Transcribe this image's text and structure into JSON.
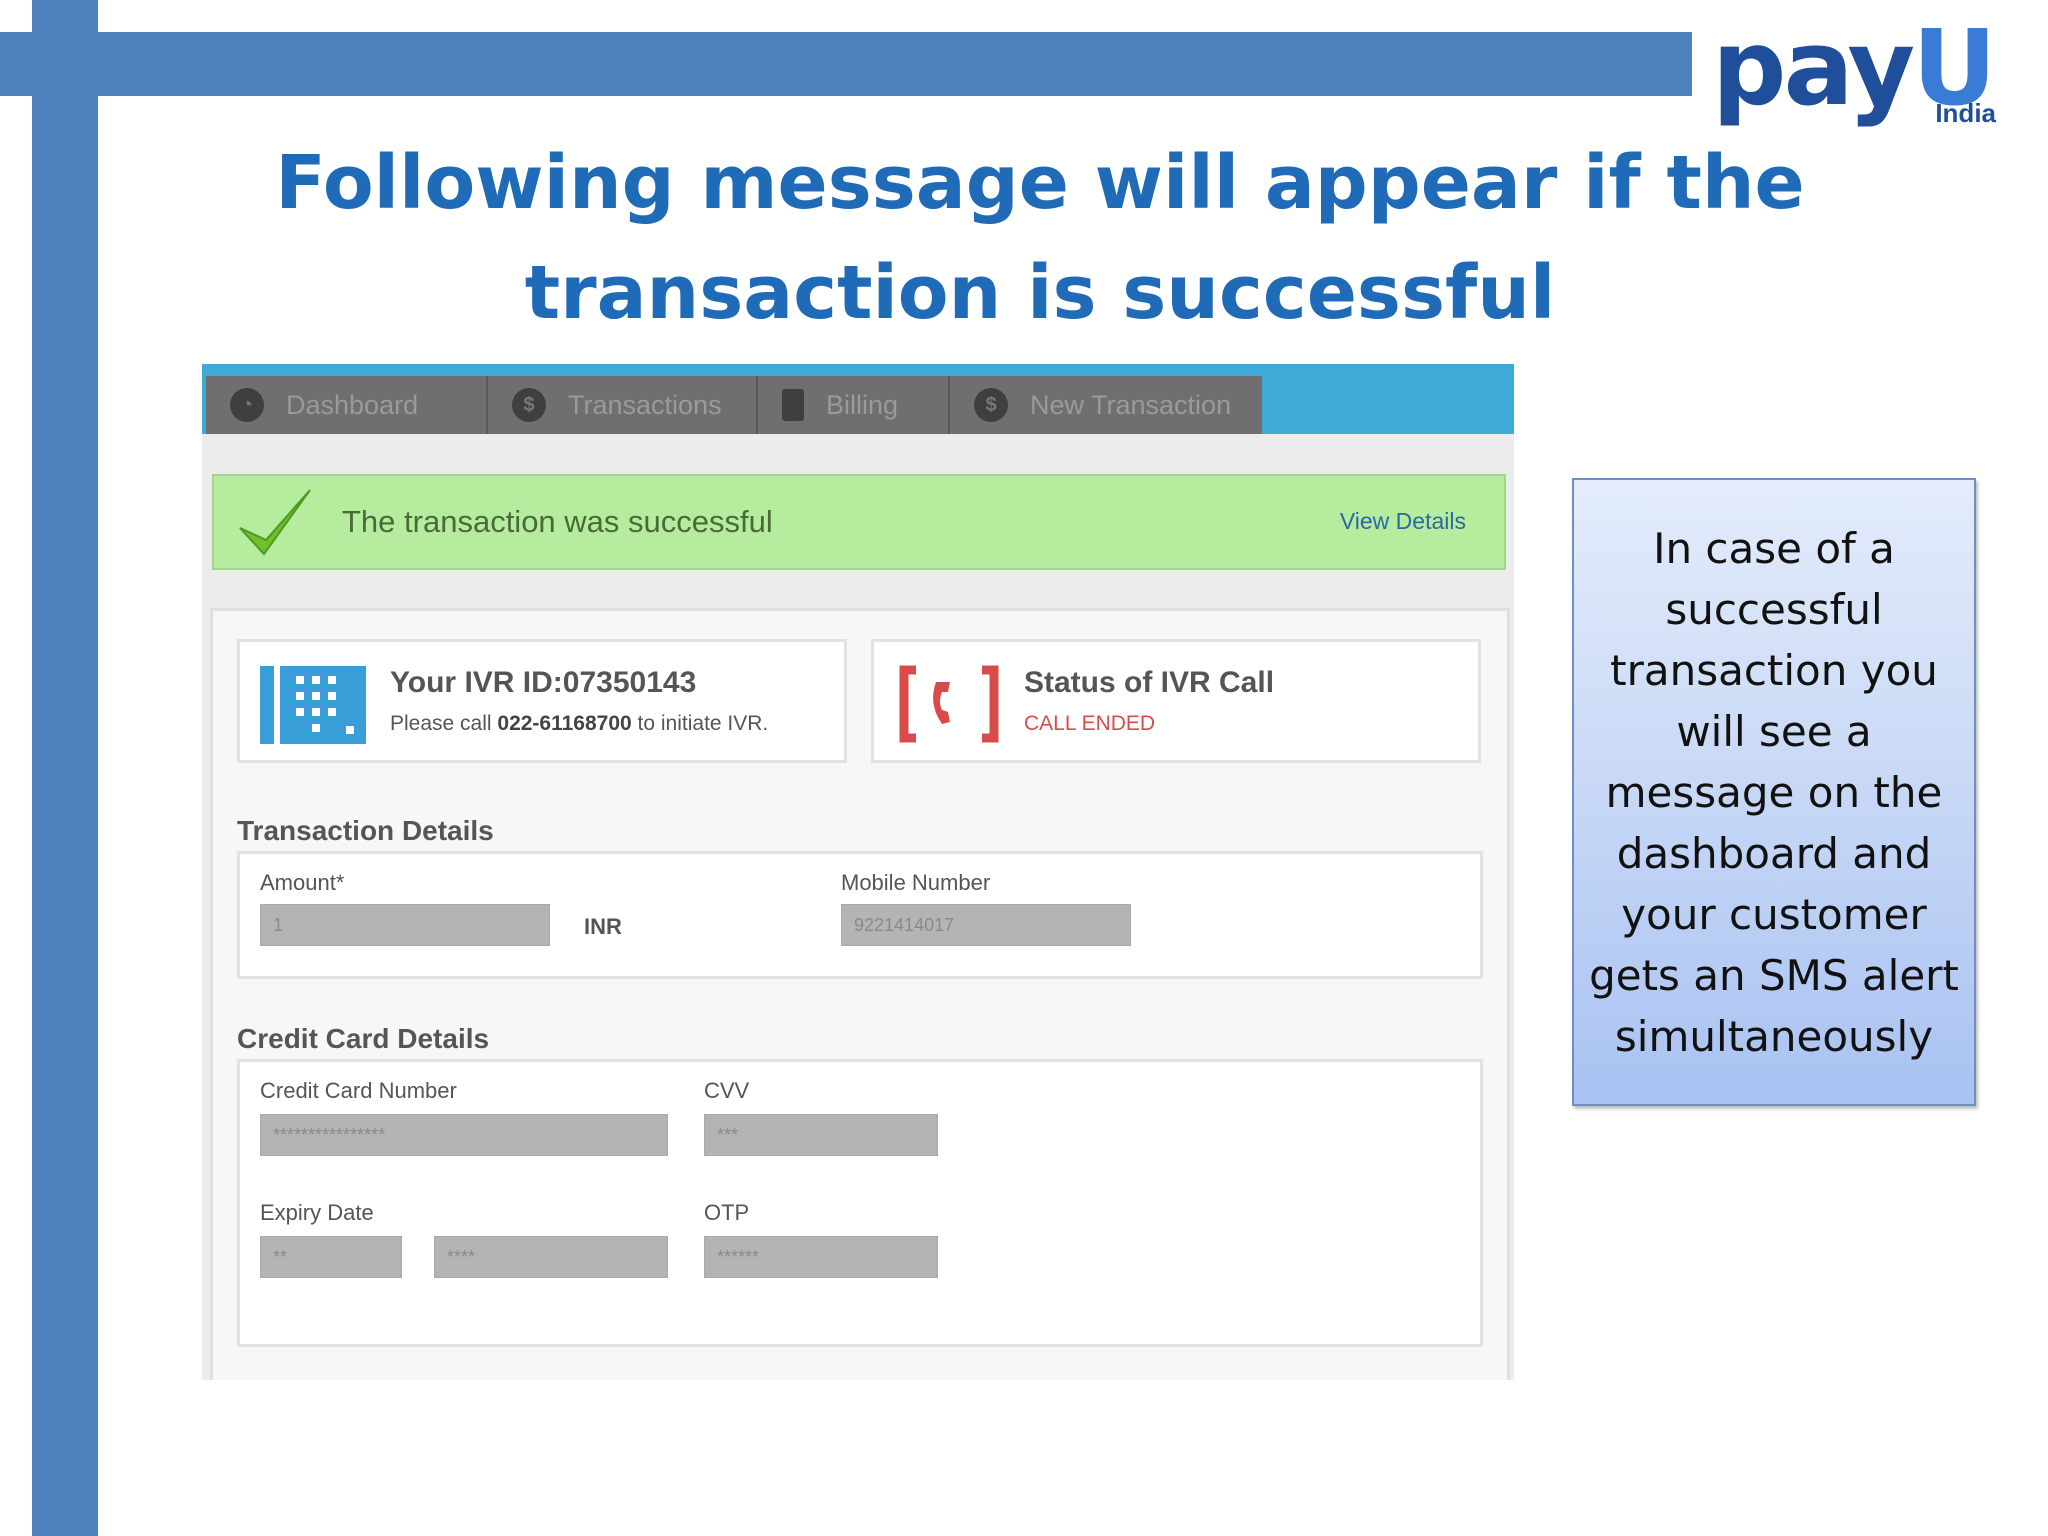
{
  "slide": {
    "title": "Following message will appear if the transaction is successful"
  },
  "logo": {
    "word_main": "pay",
    "word_accent": "U",
    "country": "India"
  },
  "colors": {
    "accent_bar": "#4f81bd",
    "title_blue": "#1f6bb8",
    "success_green": "#b5ec9d",
    "nav_blue": "#3eaad8",
    "status_red": "#d94b4b"
  },
  "nav": {
    "tabs": [
      {
        "label": "Dashboard",
        "icon": "dashboard-icon"
      },
      {
        "label": "Transactions",
        "icon": "dollar-icon"
      },
      {
        "label": "Billing",
        "icon": "billing-icon"
      },
      {
        "label": "New Transaction",
        "icon": "new-transaction-icon"
      }
    ]
  },
  "alert": {
    "message": "The transaction was successful",
    "link": "View Details",
    "icon": "checkmark-icon"
  },
  "ivr": {
    "id_title": "Your IVR ID:07350143",
    "call_prefix": "Please call ",
    "phone": "022-61168700",
    "call_suffix": " to initiate IVR.",
    "status_title": "Status of IVR Call",
    "status_value": "CALL ENDED"
  },
  "transaction": {
    "section_title": "Transaction Details",
    "amount_label": "Amount*",
    "amount_value": "1",
    "currency": "INR",
    "mobile_label": "Mobile Number",
    "mobile_value": "9221414017"
  },
  "credit_card": {
    "section_title": "Credit Card Details",
    "number_label": "Credit Card Number",
    "number_value": "****************",
    "cvv_label": "CVV",
    "cvv_value": "***",
    "expiry_label": "Expiry Date",
    "expiry_month": "**",
    "expiry_year": "****",
    "otp_label": "OTP",
    "otp_value": "******"
  },
  "note": {
    "text": "In case of a successful transaction you will see a message on the dashboard and your customer gets an SMS alert simultaneously"
  }
}
